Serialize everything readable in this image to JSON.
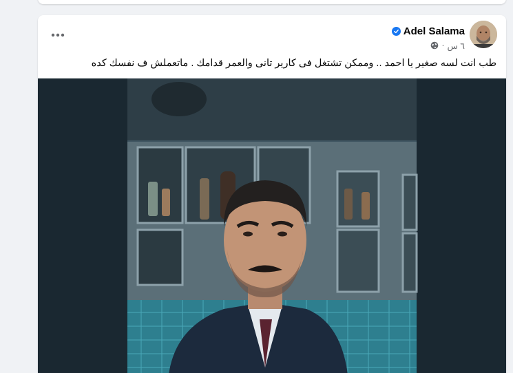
{
  "post": {
    "author_name": "Adel Salama",
    "verified_icon": "verified-badge-icon",
    "time": "٦ س",
    "separator": "·",
    "audience_icon": "globe-icon",
    "more_icon": "more-dots-icon",
    "text": "طب انت لسه صغير يا احمد .. وممكن تشتغل فى كارير تانى والعمر قدامك .  ماتعملش ف نفسك كده",
    "image_description_icon": "post-photo"
  },
  "colors": {
    "page_background": "#f0f2f5",
    "card_background": "#ffffff",
    "verified_blue": "#1877f2",
    "secondary_text": "#65676b"
  }
}
